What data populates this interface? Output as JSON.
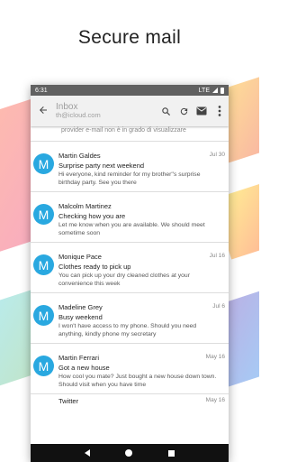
{
  "headline": "Secure mail",
  "status_bar": {
    "time": "6:31",
    "network": "LTE"
  },
  "toolbar": {
    "title": "Inbox",
    "subtitle": "th@icloud.com"
  },
  "list": {
    "clipped_text": "provider e-mail non è in grado di visualizzare",
    "messages": [
      {
        "avatar": "M",
        "sender": "Martin Galdes",
        "date": "Jul 30",
        "subject": "Surprise party next weekend",
        "preview": "Hi everyone, kind reminder for my brother''s surprise birthday party. See you there"
      },
      {
        "avatar": "M",
        "sender": "Malcolm Martinez",
        "date": "",
        "subject": "Checking how you are",
        "preview": "Let me know when you are available. We should meet sometime soon"
      },
      {
        "avatar": "M",
        "sender": "Monique Pace",
        "date": "Jul 16",
        "subject": "Clothes ready to pick up",
        "preview": "You can pick up your dry cleaned clothes at your convenience this week"
      },
      {
        "avatar": "M",
        "sender": "Madeline Grey",
        "date": "Jul 6",
        "subject": "Busy weekend",
        "preview": "I won't have access to my phone. Should you need anything, kindly phone my secretary"
      },
      {
        "avatar": "M",
        "sender": "Martin Ferrari",
        "date": "May 16",
        "subject": "Got a new house",
        "preview": "How cool you mate? Just bought a new house down town. Should visit when you have time"
      }
    ],
    "partial": {
      "sender": "Twitter",
      "date": "May 16"
    }
  }
}
